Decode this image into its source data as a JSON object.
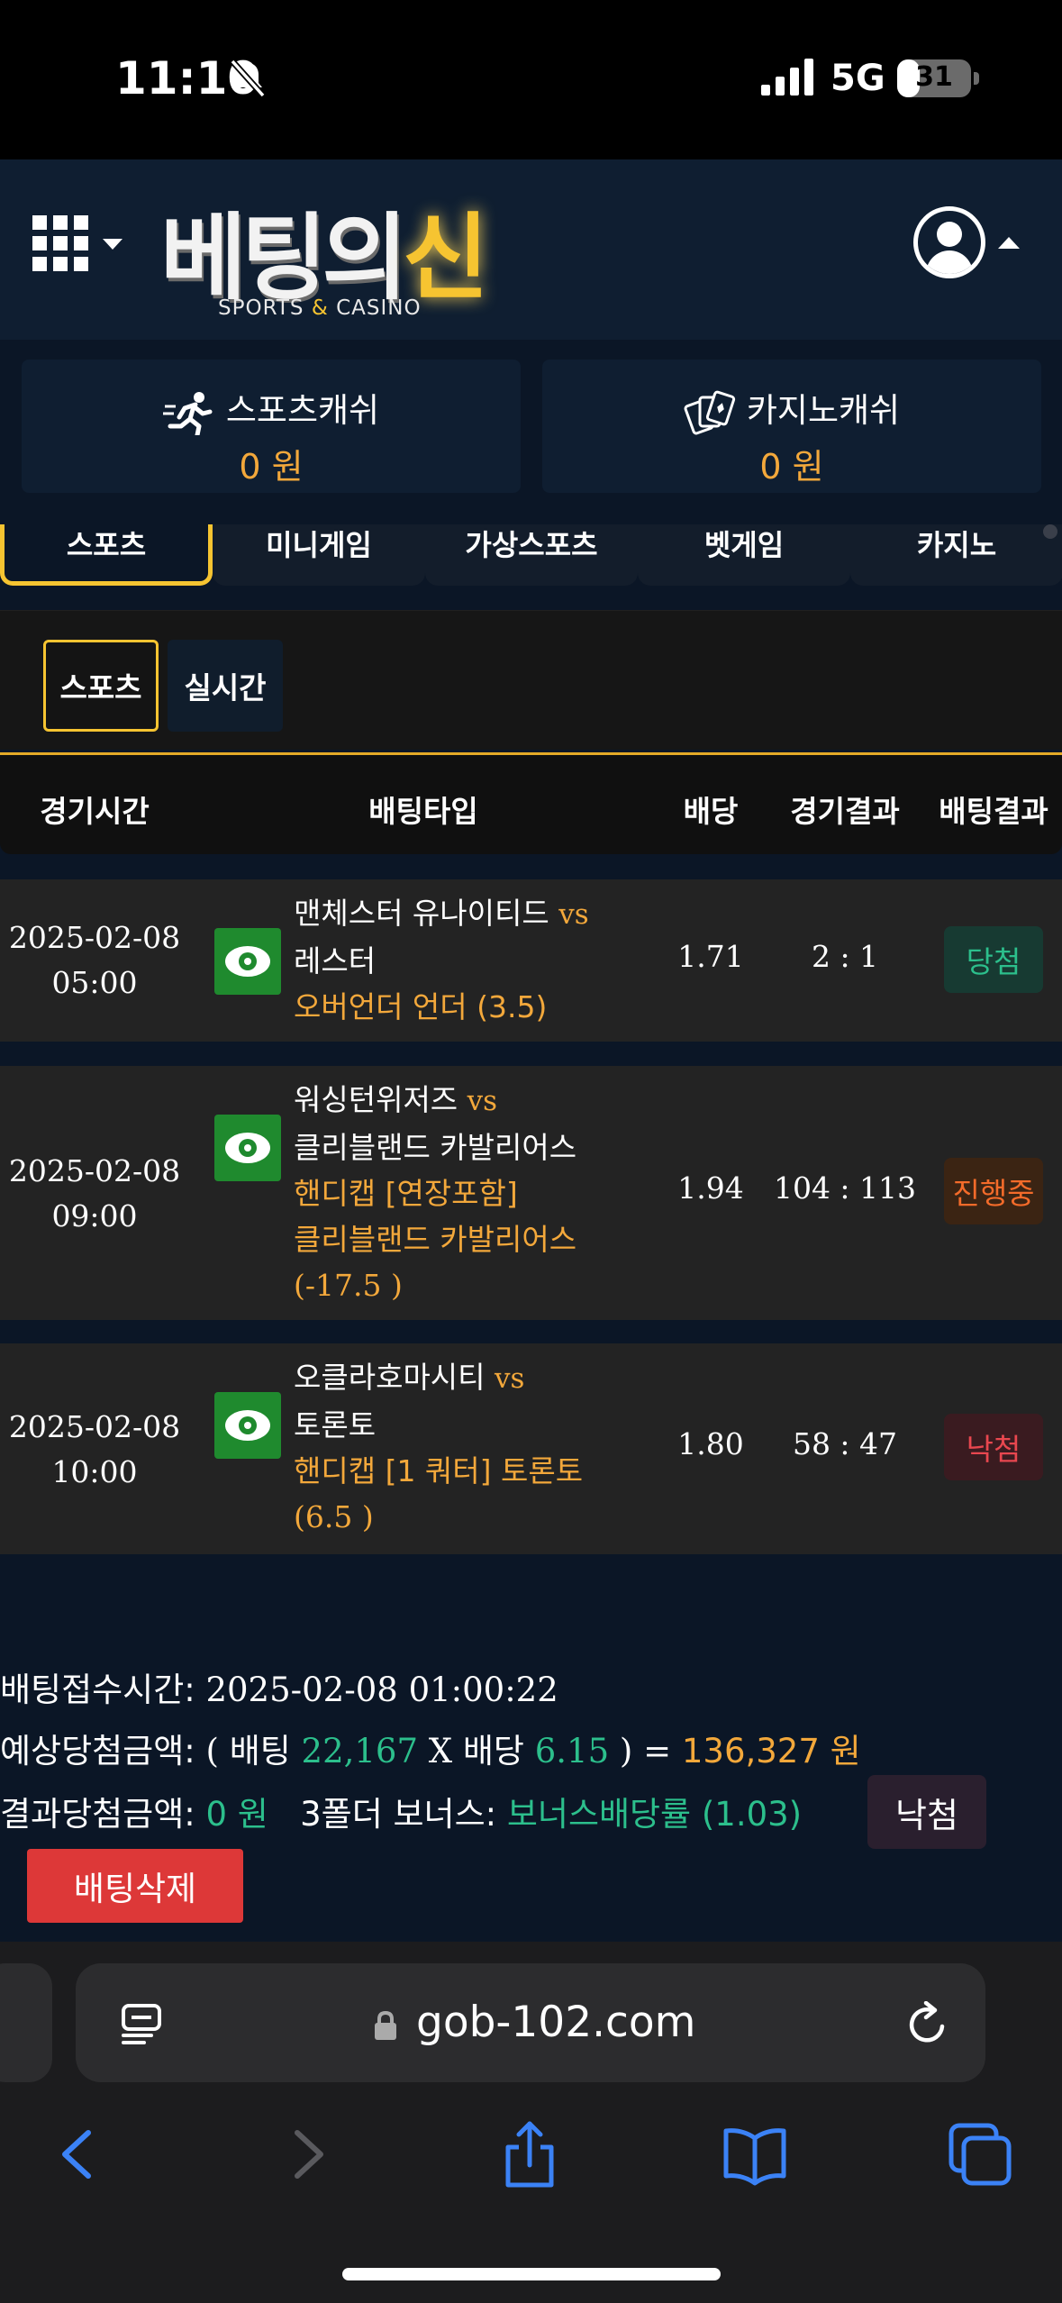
{
  "status_bar": {
    "time": "11:10",
    "network": "5G",
    "battery": "31",
    "battery_level": 0.31,
    "icons": [
      "bell-slash-icon",
      "signal-icon",
      "battery-icon"
    ]
  },
  "header": {
    "logo_text": "베팅의",
    "logo_accent": "신",
    "logo_sub_1": "SPORTS ",
    "logo_sub_amp": "&",
    "logo_sub_2": " CASINO",
    "icons": [
      "grid-menu-icon",
      "user-avatar-icon"
    ]
  },
  "wallets": [
    {
      "label": "스포츠캐쉬",
      "value": "0 원",
      "icon": "running-icon"
    },
    {
      "label": "카지노캐쉬",
      "value": "0 원",
      "icon": "cards-icon"
    }
  ],
  "menu_tabs": [
    "스포츠",
    "미니게임",
    "가상스포츠",
    "벳게임",
    "카지노"
  ],
  "sub_tabs": [
    "스포츠",
    "실시간"
  ],
  "table": {
    "headers": [
      "경기시간",
      "배팅타입",
      "배당",
      "경기결과",
      "배팅결과"
    ],
    "rows": [
      {
        "date": "2025-02-08",
        "time": "05:00",
        "team1": "맨체스터 유나이티드",
        "vs": "vs",
        "team2": "레스터",
        "bet_line1": "오버언더 언더 (3.5)",
        "bet_line2": "",
        "bet_line3": "",
        "odds": "1.71",
        "score": "2 : 1",
        "result": "당첨",
        "result_color": "#2cbf8c"
      },
      {
        "date": "2025-02-08",
        "time": "09:00",
        "team1": "워싱턴위저즈",
        "vs": "vs",
        "team2": "클리블랜드 카발리어스",
        "bet_line1": "핸디캡 [연장포함]",
        "bet_line2": "클리블랜드 카발리어스",
        "bet_line3": "(-17.5 )",
        "odds": "1.94",
        "score": "104 : 113",
        "result": "진행중",
        "result_color": "#f36b2a"
      },
      {
        "date": "2025-02-08",
        "time": "10:00",
        "team1": "오클라호마시티",
        "vs": "vs",
        "team2": "토론토",
        "bet_line1": "핸디캡 [1 쿼터] 토론토",
        "bet_line2": "(6.5 )",
        "bet_line3": "",
        "odds": "1.80",
        "score": "58 : 47",
        "result": "낙첨",
        "result_color": "#e8474f"
      }
    ]
  },
  "summary": {
    "time_label": "배팅접수시간:",
    "time_value": " 2025-02-08 01:00:22",
    "expected_label": "예상당첨금액:",
    "expected_open": " ( ",
    "bet_word": "배팅",
    "bet_amount": "22,167",
    "x": " X ",
    "odds_word": "배당",
    "total_odds": "6.15",
    "close_eq": " ) = ",
    "expected_amount": "136,327 원",
    "result_label": "결과당첨금액:",
    "result_amount": "0 원",
    "bonus_label": "3폴더 보너스:",
    "bonus_value": "보너스배당률 (1.03)",
    "status_button": "낙첨",
    "delete_button": "배팅삭제"
  },
  "browser": {
    "host": "gob-102.com",
    "icons": [
      "reader-icon",
      "lock-icon",
      "reload-icon",
      "back-icon",
      "forward-icon",
      "share-icon",
      "bookmarks-icon",
      "tabs-icon"
    ]
  },
  "colors": {
    "accent_gold": "#f6c431",
    "orange": "#f3a83b",
    "green": "#2cbf8c",
    "delete_red": "#dd3838",
    "panel_navy": "#0f1e31"
  }
}
